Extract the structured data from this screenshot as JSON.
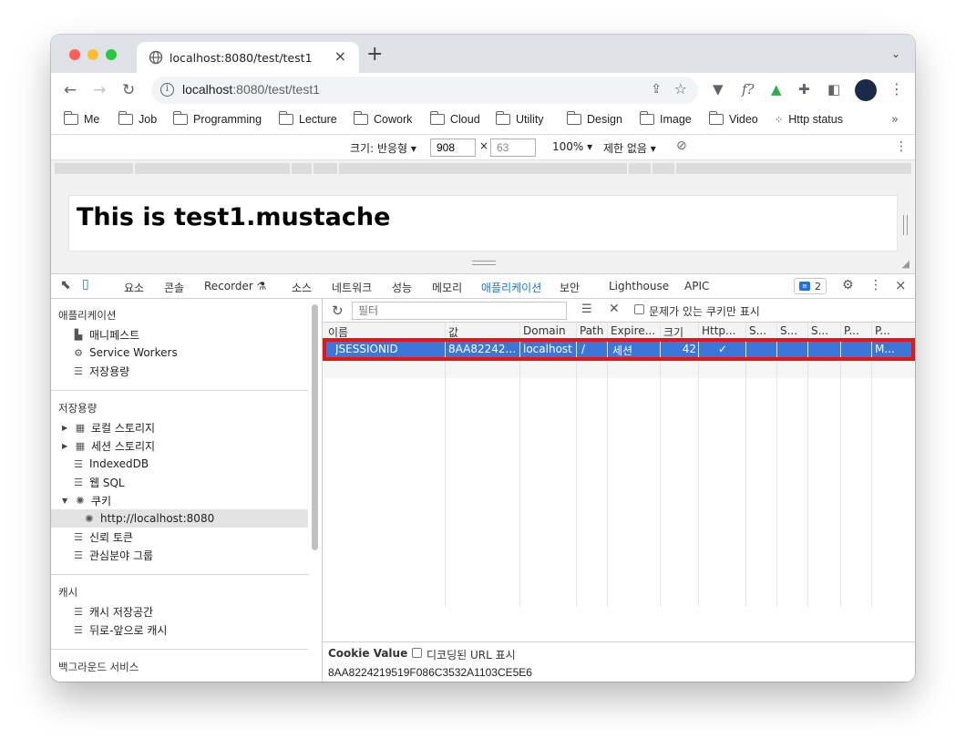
{
  "browser": {
    "tab_title": "localhost:8080/test/test1",
    "url_host": "localhost",
    "url_path": ":8080/test/test1",
    "bookmarks": [
      "Me",
      "Job",
      "Programming",
      "Lecture",
      "Cowork",
      "Cloud",
      "Utility",
      "Design",
      "Image",
      "Video",
      "Http status"
    ],
    "bookmarks_more": "»"
  },
  "device_toolbar": {
    "size_label": "크기: 반응형 ▾",
    "width": "908",
    "times": "×",
    "height": "63",
    "zoom": "100% ▾",
    "throttle": "제한 없음 ▾"
  },
  "page": {
    "heading": "This is test1.mustache"
  },
  "devtools": {
    "tabs": [
      "요소",
      "콘솔",
      "Recorder ⚗",
      "소스",
      "네트워크",
      "성능",
      "메모리",
      "애플리케이션",
      "보안",
      "Lighthouse",
      "APIC"
    ],
    "active_tab": "애플리케이션",
    "issues_count": "2",
    "sidebar": {
      "section_app": "애플리케이션",
      "app_items": [
        "매니페스트",
        "Service Workers",
        "저장용량"
      ],
      "section_storage": "저장용량",
      "storage_items": [
        "로컬 스토리지",
        "세션 스토리지",
        "IndexedDB",
        "웹 SQL",
        "쿠키"
      ],
      "cookie_origin": "http://localhost:8080",
      "storage_items_after": [
        "신뢰 토큰",
        "관심분야 그룹"
      ],
      "section_cache": "캐시",
      "cache_items": [
        "캐시 저장공간",
        "뒤로-앞으로 캐시"
      ],
      "section_bg": "백그라운드 서비스"
    },
    "filter": {
      "placeholder": "필터",
      "only_issues_label": "문제가 있는 쿠키만 표시"
    },
    "table": {
      "headers": [
        "이름",
        "값",
        "Domain",
        "Path",
        "Expire...",
        "크기",
        "Http...",
        "S...",
        "S...",
        "S...",
        "P...",
        "P..."
      ],
      "row": [
        "JSESSIONID",
        "8AA82242...",
        "localhost",
        "/",
        "세션",
        "42",
        "✓",
        "",
        "",
        "",
        "",
        "M..."
      ]
    },
    "cookie_value": {
      "title": "Cookie Value",
      "decode_label": "디코딩된 URL 표시",
      "value": "8AA8224219519F086C3532A1103CE5E6"
    }
  },
  "colors": {
    "accent": "#1a73e8",
    "selected_row": "#3b76d9",
    "highlight_box": "#e8141a"
  }
}
